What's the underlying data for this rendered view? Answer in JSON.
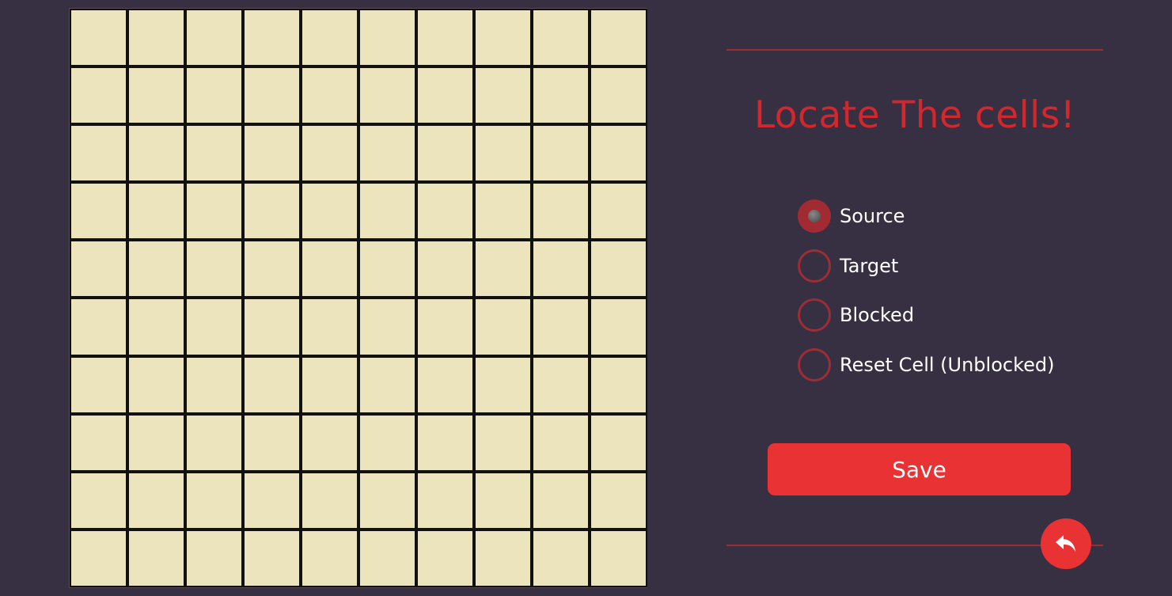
{
  "grid": {
    "rows": 10,
    "columns": 10,
    "cell_color": "#ebe4bc",
    "border_color": "#111111"
  },
  "panel": {
    "title": "Locate The cells!",
    "options": [
      {
        "label": "Source",
        "checked": true
      },
      {
        "label": "Target",
        "checked": false
      },
      {
        "label": "Blocked",
        "checked": false
      },
      {
        "label": "Reset Cell (Unblocked)",
        "checked": false
      }
    ],
    "save_label": "Save",
    "back_icon": "undo-arrow-icon"
  },
  "colors": {
    "background": "#372f42",
    "accent": "#e83233",
    "title": "#d3272e",
    "rule": "#9b2d35"
  }
}
